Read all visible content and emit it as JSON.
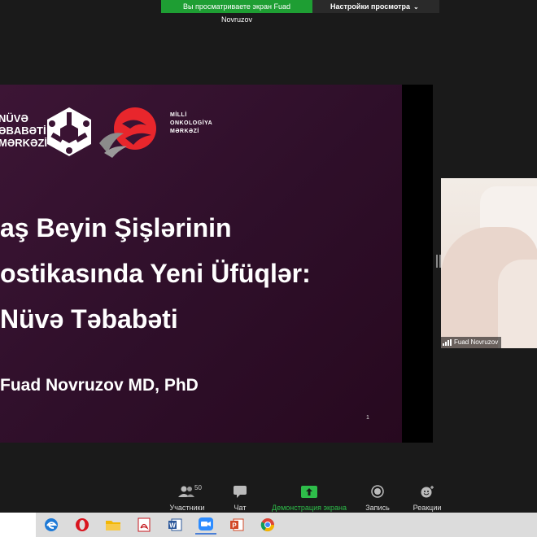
{
  "banner": {
    "viewing_text": "Вы просматриваете экран Fuad Novruzov",
    "options_label": "Настройки просмотра",
    "options_icon": "chevron-down-icon"
  },
  "slide": {
    "logo_left_lines": [
      "NÜVƏ",
      "ƏBABƏTİ",
      "MƏRKƏZİ"
    ],
    "logo_right_lines": [
      "MİLLİ",
      "ONKOLOGİYA",
      "MƏRKƏZİ"
    ],
    "title_lines": [
      "aş Beyin Şişlərinin",
      "ostikasında Yeni Üfüqlər:",
      "Nüvə Təbabəti"
    ],
    "author": "Fuad Novruzov MD, PhD",
    "page_number": "1",
    "colors": {
      "background": "#34112f",
      "accent_red": "#e8262c"
    }
  },
  "video": {
    "participant_name": "Fuad Novruzov"
  },
  "controls": [
    {
      "label": "Участники",
      "icon": "participants-icon",
      "count": "50"
    },
    {
      "label": "Чат",
      "icon": "chat-icon"
    },
    {
      "label": "Демонстрация экрана",
      "icon": "share-screen-icon",
      "color": "#2ebd4a"
    },
    {
      "label": "Запись",
      "icon": "record-icon"
    },
    {
      "label": "Реакции",
      "icon": "reactions-icon"
    }
  ],
  "taskbar": {
    "apps": [
      "edge-icon",
      "opera-icon",
      "file-explorer-icon",
      "acrobat-icon",
      "word-icon",
      "zoom-icon",
      "powerpoint-icon",
      "chrome-icon"
    ],
    "active_app": "zoom-icon"
  }
}
